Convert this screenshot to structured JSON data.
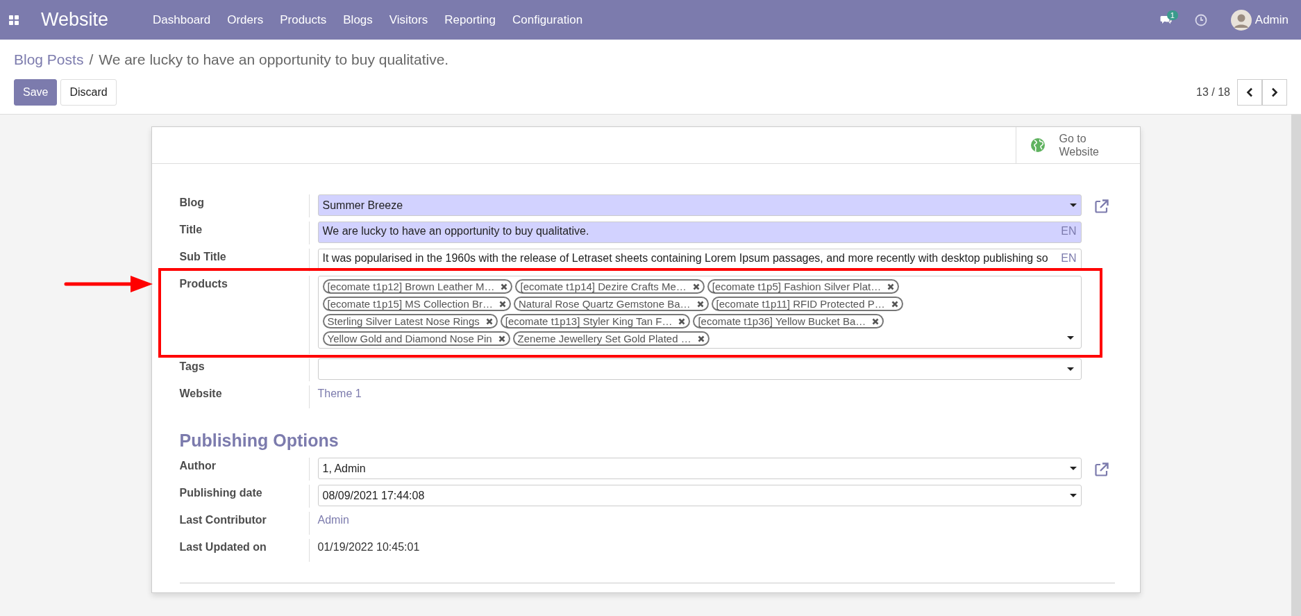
{
  "navbar": {
    "app_name": "Website",
    "menu": [
      "Dashboard",
      "Orders",
      "Products",
      "Blogs",
      "Visitors",
      "Reporting",
      "Configuration"
    ],
    "messages_count": "1",
    "user": "Admin"
  },
  "breadcrumb": {
    "parent": "Blog Posts",
    "separator": "/",
    "current": "We are lucky to have an opportunity to buy qualitative."
  },
  "buttons": [
    {
      "label": "Save",
      "kind": "primary"
    },
    {
      "label": "Discard",
      "kind": "secondary"
    }
  ],
  "pager": {
    "text": "13 / 18"
  },
  "button_box": [
    {
      "label": "Go to Website"
    }
  ],
  "sections": [
    {
      "fields": [
        {
          "label": "Blog",
          "kind": "select",
          "value": "Summer Breeze",
          "required": true,
          "external_link": true
        },
        {
          "label": "Title",
          "kind": "translatable",
          "value": "We are lucky to have an opportunity to buy qualitative.",
          "required": true,
          "lang": "EN"
        },
        {
          "label": "Sub Title",
          "kind": "translatable",
          "value": "It was popularised in the 1960s with the release of Letraset sheets containing Lorem Ipsum passages, and more recently with desktop publishing so",
          "required": false,
          "lang": "EN"
        },
        {
          "label": "Products",
          "kind": "tags",
          "required": false,
          "tags": [
            "[ecomate  t1p12] Brown Leather M…",
            "[ecomate  t1p14] Dezire Crafts Me…",
            "[ecomate  t1p5] Fashion Silver Plat…",
            "[ecomate  t1p15] MS Collection Br…",
            "Natural Rose Quartz Gemstone Ba…",
            "[ecomate  t1p11] RFID Protected P…",
            "Sterling Silver Latest Nose Rings",
            "[ecomate  t1p13] Styler King Tan F…",
            "[ecomate  t1p36] Yellow Bucket Ba…",
            "Yellow Gold and Diamond Nose Pin",
            "Zeneme Jewellery Set Gold Plated …"
          ]
        },
        {
          "label": "Tags",
          "kind": "tags",
          "required": false
        },
        {
          "label": "Website",
          "kind": "link",
          "value": "Theme 1"
        }
      ]
    },
    {
      "title": "Publishing Options",
      "fields": [
        {
          "label": "Author",
          "kind": "select",
          "value": "1, Admin",
          "required": false,
          "external_link": true
        },
        {
          "label": "Publishing date",
          "kind": "select",
          "value": "08/09/2021 17:44:08",
          "required": false
        },
        {
          "label": "Last Contributor",
          "kind": "link",
          "value": "Admin"
        },
        {
          "label": "Last Updated on",
          "kind": "text",
          "value": "01/19/2022 10:45:01"
        }
      ]
    }
  ]
}
